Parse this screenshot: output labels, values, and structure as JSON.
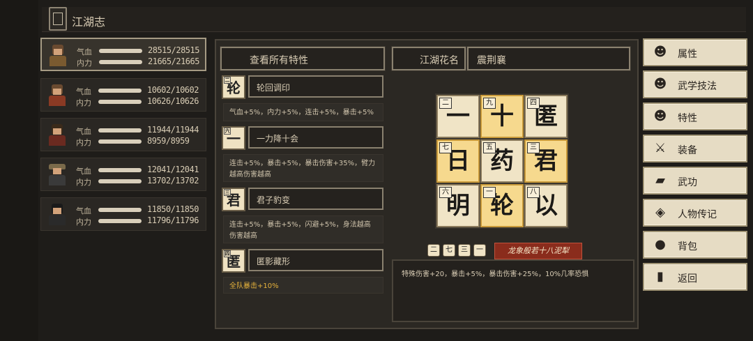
{
  "header": {
    "title": "江湖志"
  },
  "characters": [
    {
      "hp_label": "气血",
      "mp_label": "内力",
      "hp": "28515/28515",
      "mp": "21665/21665"
    },
    {
      "hp_label": "气血",
      "mp_label": "内力",
      "hp": "10602/10602",
      "mp": "10626/10626"
    },
    {
      "hp_label": "气血",
      "mp_label": "内力",
      "hp": "11944/11944",
      "mp": "8959/8959"
    },
    {
      "hp_label": "气血",
      "mp_label": "内力",
      "hp": "12041/12041",
      "mp": "13702/13702"
    },
    {
      "hp_label": "气血",
      "mp_label": "内力",
      "hp": "11850/11850",
      "mp": "11796/11796"
    }
  ],
  "panel": {
    "view_all_label": "查看所有特性",
    "nickname_label": "江湖花名",
    "nickname_value": "震荆襄"
  },
  "traits": [
    {
      "char": "轮",
      "small": "二",
      "name": "轮回调印",
      "desc": "气血+5%，内力+5%，连击+5%，暴击+5%"
    },
    {
      "char": "一",
      "small": "六",
      "name": "一力降十会",
      "desc": "连击+5%，暴击+5%，暴击伤害+35%，臂力越高伤害越高"
    },
    {
      "char": "君",
      "small": "三",
      "name": "君子豹变",
      "desc": "连击+5%，暴击+5%，闪避+5%，身法越高伤害越高"
    },
    {
      "char": "匿",
      "small": "四",
      "name": "匿影藏形",
      "desc": "全队暴击+10%"
    }
  ],
  "grid": [
    {
      "char": "一",
      "num": "二",
      "hl": false
    },
    {
      "char": "十",
      "num": "九",
      "hl": true
    },
    {
      "char": "匿",
      "num": "四",
      "hl": false
    },
    {
      "char": "日",
      "num": "七",
      "hl": true
    },
    {
      "char": "药",
      "num": "五",
      "hl": false
    },
    {
      "char": "君",
      "num": "三",
      "hl": true
    },
    {
      "char": "明",
      "num": "六",
      "hl": false
    },
    {
      "char": "轮",
      "num": "一",
      "hl": true
    },
    {
      "char": "以",
      "num": "八",
      "hl": false
    }
  ],
  "combo": {
    "runes": [
      "二",
      "七",
      "三",
      "一"
    ],
    "title": "龙象般若十八泥犁",
    "desc": "特殊伤害+20，暴击+5%，暴击伤害+25%，10%几率恐惧"
  },
  "side_menu": [
    {
      "label": "属性",
      "icon": "person-icon",
      "glyph": "☻"
    },
    {
      "label": "武学技法",
      "icon": "skill-icon",
      "glyph": "☻"
    },
    {
      "label": "特性",
      "icon": "trait-icon",
      "glyph": "☻"
    },
    {
      "label": "装备",
      "icon": "sword-icon",
      "glyph": "⚔"
    },
    {
      "label": "武功",
      "icon": "manual-icon",
      "glyph": "▰"
    },
    {
      "label": "人物传记",
      "icon": "scroll-icon",
      "glyph": "◈"
    },
    {
      "label": "背包",
      "icon": "bag-icon",
      "glyph": "●"
    },
    {
      "label": "返回",
      "icon": "door-icon",
      "glyph": "▮"
    }
  ]
}
